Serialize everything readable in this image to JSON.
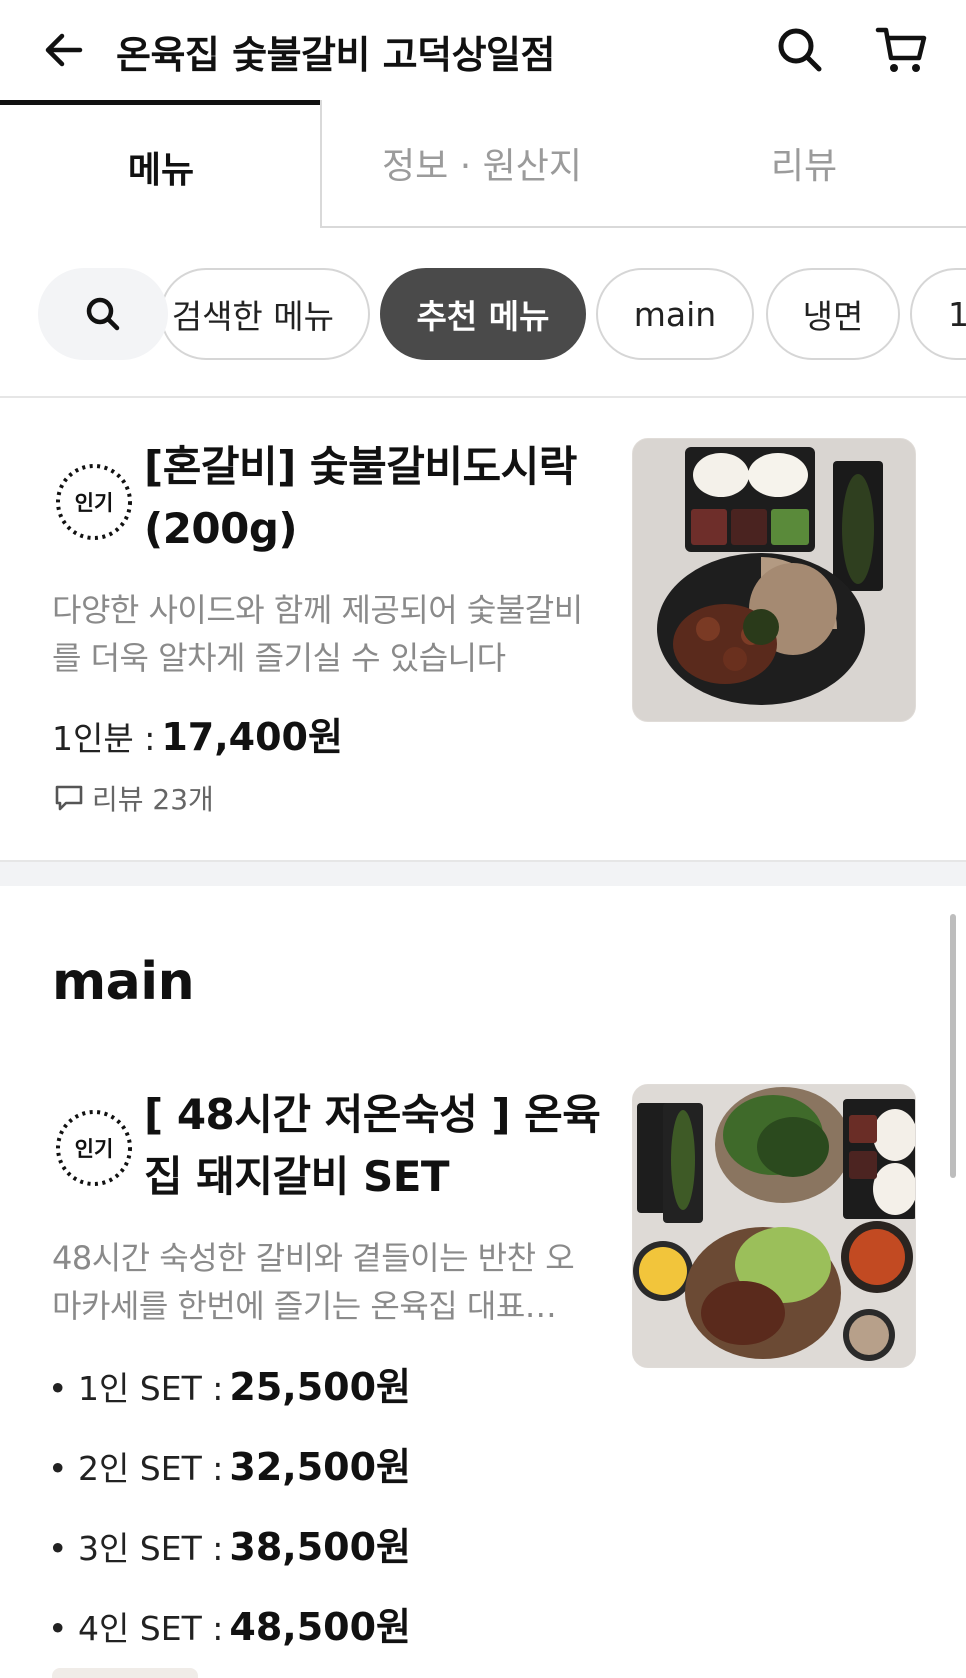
{
  "header": {
    "title": "온육집 숯불갈비 고덕상일점"
  },
  "tabs": [
    {
      "label": "메뉴",
      "active": true
    },
    {
      "label": "정보 · 원산지",
      "active": false
    },
    {
      "label": "리뷰",
      "active": false
    }
  ],
  "chips": {
    "items": [
      "검색한 메뉴",
      "추천 메뉴",
      "main",
      "냉면",
      "1"
    ],
    "selected": "추천 메뉴"
  },
  "recommended": {
    "item": {
      "badge": "인기",
      "name_line1": "[혼갈비] 숯불갈비도시락",
      "name_line2": "(200g)",
      "desc_line1": "다양한 사이드와 함께 제공되어 숯불갈비",
      "desc_line2": "를 더욱 알차게 즐기실 수 있습니다",
      "price_label": "1인분 :",
      "price_value": "17,400원",
      "review_text": "리뷰 23개"
    }
  },
  "main_section": {
    "title": "main",
    "item": {
      "badge": "인기",
      "name_line1": "[ 48시간 저온숙성 ] 온육",
      "name_line2": "집 돼지갈비 SET",
      "desc_line1": "48시간 숙성한 갈비와 곁들이는 반찬 오",
      "desc_line2": "마카세를 한번에 즐기는 온육집 대표…",
      "prices": [
        {
          "label": "• 1인 SET :",
          "value": "25,500원"
        },
        {
          "label": "• 2인 SET :",
          "value": "32,500원"
        },
        {
          "label": "• 3인 SET :",
          "value": "38,500원"
        },
        {
          "label": "• 4인 SET :",
          "value": "48,500원"
        }
      ]
    }
  },
  "icons": {
    "back": "arrow-left-icon",
    "search": "search-icon",
    "cart": "cart-icon",
    "review": "comment-icon"
  },
  "colors": {
    "selected_chip": "#4a4a4a",
    "muted_text": "#8a8a8a",
    "inactive_tab": "#9b9b9b"
  }
}
